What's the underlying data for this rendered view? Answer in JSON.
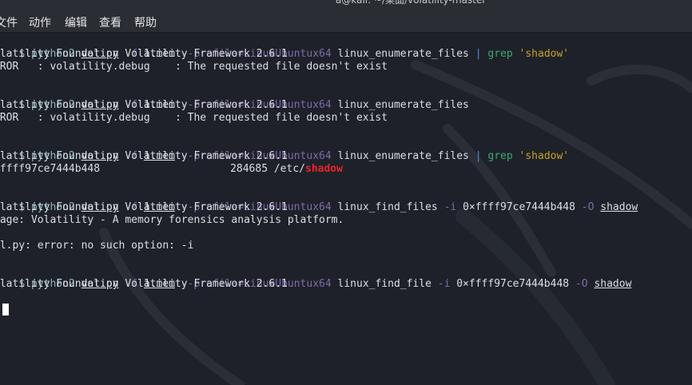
{
  "window": {
    "title": "a@kali: ~/桌面/volatility-master"
  },
  "menu": {
    "items": [
      "文件",
      "动作",
      "编辑",
      "查看",
      "帮助"
    ]
  },
  "terminal": {
    "blocks": [
      {
        "cmd": {
          "interp": "python2",
          "script": "vol.py",
          "f_flag": "-f",
          "mem": "1.mem",
          "profile": "--profile=LinuxUbuntux64",
          "plugin": "linux_enumerate_files",
          "pipe": "|",
          "grep": "grep",
          "pattern": "'shadow'"
        },
        "out": [
          "olatility Foundation Volatility Framework 2.6.1",
          "RROR   : volatility.debug    : The requested file doesn't exist"
        ]
      },
      {
        "cmd": {
          "interp": "python2",
          "script": "vol.py",
          "f_flag": "-f",
          "mem": "1.mem",
          "profile": "--profile=LinuxUbuntux64",
          "plugin": "linux_enumerate_files"
        },
        "out": [
          "olatility Foundation Volatility Framework 2.6.1",
          "RROR   : volatility.debug    : The requested file doesn't exist"
        ]
      },
      {
        "cmd": {
          "interp": "python2",
          "script": "vol.py",
          "f_flag": "-f",
          "mem": "1.mem",
          "profile": "--profile=LinuxUbuntux64",
          "plugin": "linux_enumerate_files",
          "pipe": "|",
          "grep": "grep",
          "pattern": "'shadow'"
        },
        "out": [
          "olatility Foundation Volatility Framework 2.6.1"
        ],
        "result": {
          "addr": "xffff97ce7444b448",
          "inode": "284685",
          "path_prefix": "/etc/",
          "match": "shadow"
        }
      },
      {
        "cmd": {
          "interp": "python2",
          "script": "vol.py",
          "f_flag": "-f",
          "mem": "1.mem",
          "profile": "--profile=LinuxUbuntux64",
          "plugin": "linux_find_files",
          "i_flag": "-i",
          "addr": "0×ffff97ce7444b448",
          "o_flag": "-O",
          "outfile": "shadow"
        },
        "out": [
          "olatility Foundation Volatility Framework 2.6.1",
          "sage: Volatility - A memory forensics analysis platform.",
          "",
          "ol.py: error: no such option: -i"
        ]
      },
      {
        "cmd": {
          "interp": "python2",
          "script": "vol.py",
          "f_flag": "-f",
          "mem": "1.mem",
          "profile": "--profile=LinuxUbuntux64",
          "plugin": "linux_find_file",
          "i_flag": "-i",
          "addr": "0×ffff97ce7444b448",
          "o_flag": "-O",
          "outfile": "shadow"
        },
        "out": [
          "olatility Foundation Volatility Framework 2.6.1"
        ]
      }
    ]
  },
  "colors": {
    "background": "#1e2129",
    "menubar": "#2a2d34",
    "text": "#dcdfe4",
    "prompt": "#8ab4b8",
    "option": "#7d6ba8",
    "pipe": "#4b8ee0",
    "grep": "#3aa872",
    "string": "#c9a227",
    "match": "#e5262b"
  },
  "icons": {
    "background": "kali-dragon-watermark",
    "cursor": "block-cursor"
  }
}
